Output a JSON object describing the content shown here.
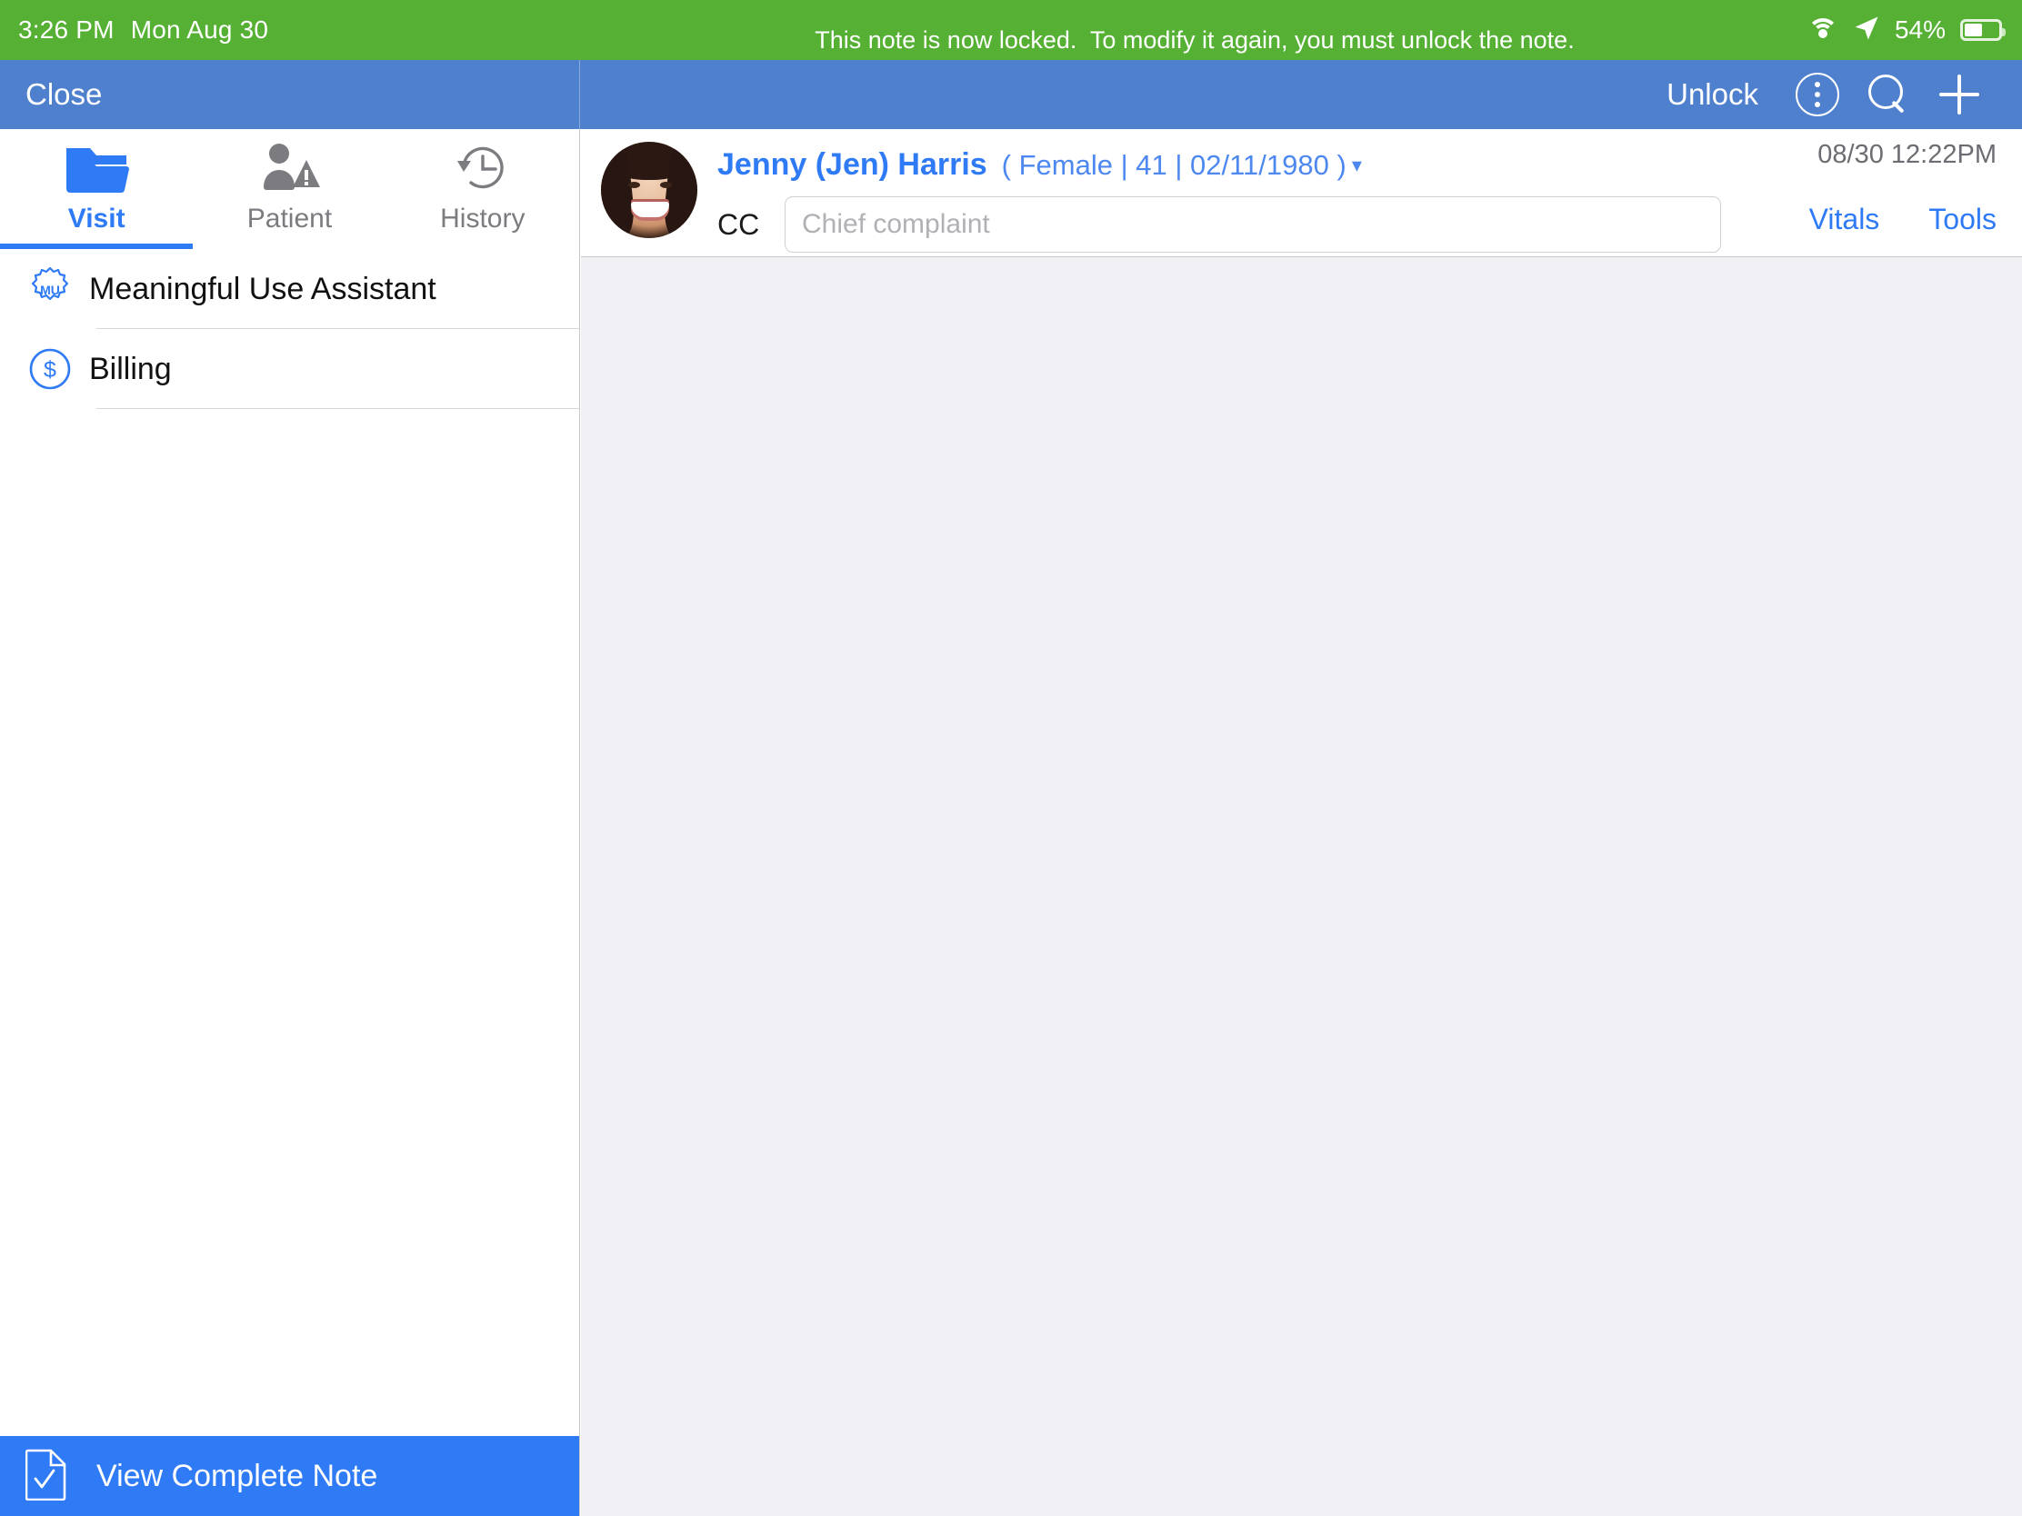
{
  "status_bar": {
    "time": "3:26 PM",
    "date": "Mon Aug 30",
    "battery_percent": "54%",
    "wifi_icon": "wifi-icon",
    "location_icon": "location-arrow-icon",
    "battery_icon": "battery-icon",
    "background_color": "#55b034"
  },
  "banner": {
    "message": "This note is now locked.  To modify it again, you must unlock the note."
  },
  "navbar": {
    "close_label": "Close",
    "unlock_label": "Unlock",
    "menu_icon": "kebab-menu-icon",
    "search_icon": "search-icon",
    "add_icon": "plus-icon",
    "background_color": "#4f80ce"
  },
  "sidebar": {
    "tabs": [
      {
        "label": "Visit",
        "icon": "folder-icon",
        "active": true
      },
      {
        "label": "Patient",
        "icon": "person-warning-icon",
        "active": false
      },
      {
        "label": "History",
        "icon": "clock-rewind-icon",
        "active": false
      }
    ],
    "items": [
      {
        "label": "Meaningful Use Assistant",
        "icon": "mu-badge-icon"
      },
      {
        "label": "Billing",
        "icon": "dollar-circle-icon"
      }
    ],
    "footer_button": {
      "label": "View Complete Note",
      "icon": "note-check-icon",
      "color": "#2f7af5"
    }
  },
  "patient_header": {
    "avatar_icon": "patient-avatar",
    "name": "Jenny (Jen) Harris",
    "demographics": "( Female | 41 | 02/11/1980 )",
    "caret_icon": "chevron-down-icon",
    "cc_label": "CC",
    "cc_value": "",
    "cc_placeholder": "Chief complaint",
    "visit_datetime": "08/30 12:22PM",
    "actions": [
      {
        "label": "Vitals"
      },
      {
        "label": "Tools"
      }
    ]
  },
  "theme": {
    "accent_blue": "#2f7af5",
    "nav_blue": "#4f80ce",
    "status_green": "#55b034",
    "content_bg": "#f0f0f4"
  }
}
